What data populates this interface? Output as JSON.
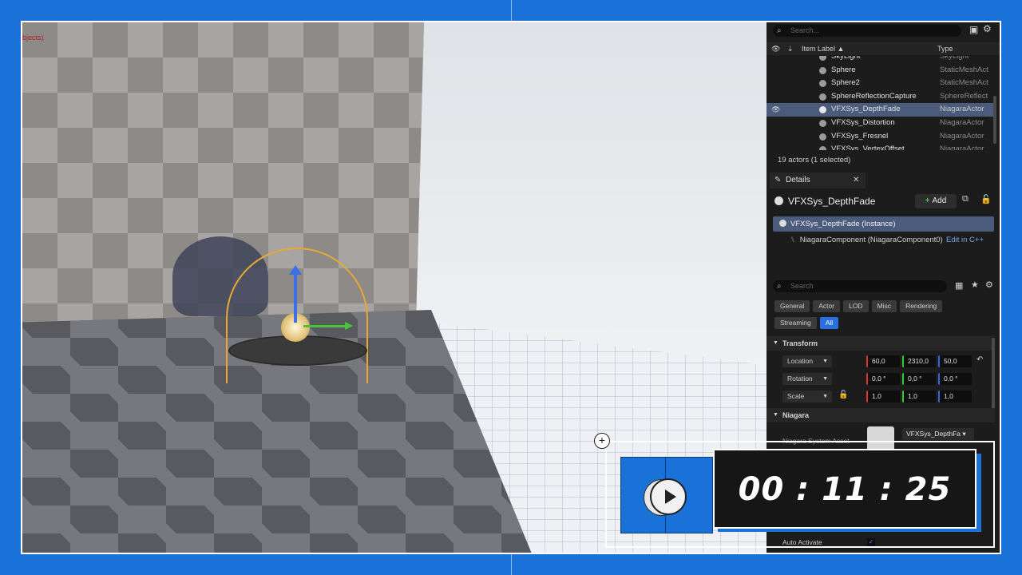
{
  "viewport": {
    "label": "bjects)"
  },
  "outliner": {
    "search_placeholder": "Search...",
    "col_label": "Item Label ▲",
    "col_type": "Type",
    "rows": [
      {
        "name": "SkyLight",
        "type": "SkyLight",
        "selected": false
      },
      {
        "name": "Sphere",
        "type": "StaticMeshAct",
        "selected": false
      },
      {
        "name": "Sphere2",
        "type": "StaticMeshAct",
        "selected": false
      },
      {
        "name": "SphereReflectionCapture",
        "type": "SphereReflect",
        "selected": false
      },
      {
        "name": "VFXSys_DepthFade",
        "type": "NiagaraActor",
        "selected": true
      },
      {
        "name": "VFXSys_Distortion",
        "type": "NiagaraActor",
        "selected": false
      },
      {
        "name": "VFXSys_Fresnel",
        "type": "NiagaraActor",
        "selected": false
      },
      {
        "name": "VFXSys_VertexOffset",
        "type": "NiagaraActor",
        "selected": false
      }
    ],
    "status": "19 actors (1 selected)"
  },
  "details": {
    "tab_label": "Details",
    "actor_name": "VFXSys_DepthFade",
    "add_label": "Add",
    "instance_label": "VFXSys_DepthFade (Instance)",
    "component_label": "NiagaraComponent (NiagaraComponent0)",
    "edit_link": "Edit in C++",
    "search_placeholder": "Search",
    "categories": [
      "General",
      "Actor",
      "LOD",
      "Misc",
      "Rendering",
      "Streaming",
      "All"
    ],
    "transform": {
      "title": "Transform",
      "location": {
        "label": "Location",
        "x": "60,0",
        "y": "2310,0",
        "z": "50,0"
      },
      "rotation": {
        "label": "Rotation",
        "x": "0,0 °",
        "y": "0,0 °",
        "z": "0,0 °"
      },
      "scale": {
        "label": "Scale",
        "x": "1,0",
        "y": "1,0",
        "z": "1,0"
      }
    },
    "niagara": {
      "title": "Niagara",
      "asset_label": "Niagara System Asset",
      "asset_value": "VFXSys_DepthFa",
      "auto_activate": "Auto Activate"
    }
  },
  "overlay": {
    "timer": "00 : 11 : 25"
  },
  "colors": {
    "accent": "#1a72d9",
    "selection": "#4a5b7c",
    "panel_bg": "#1c1c1c"
  }
}
